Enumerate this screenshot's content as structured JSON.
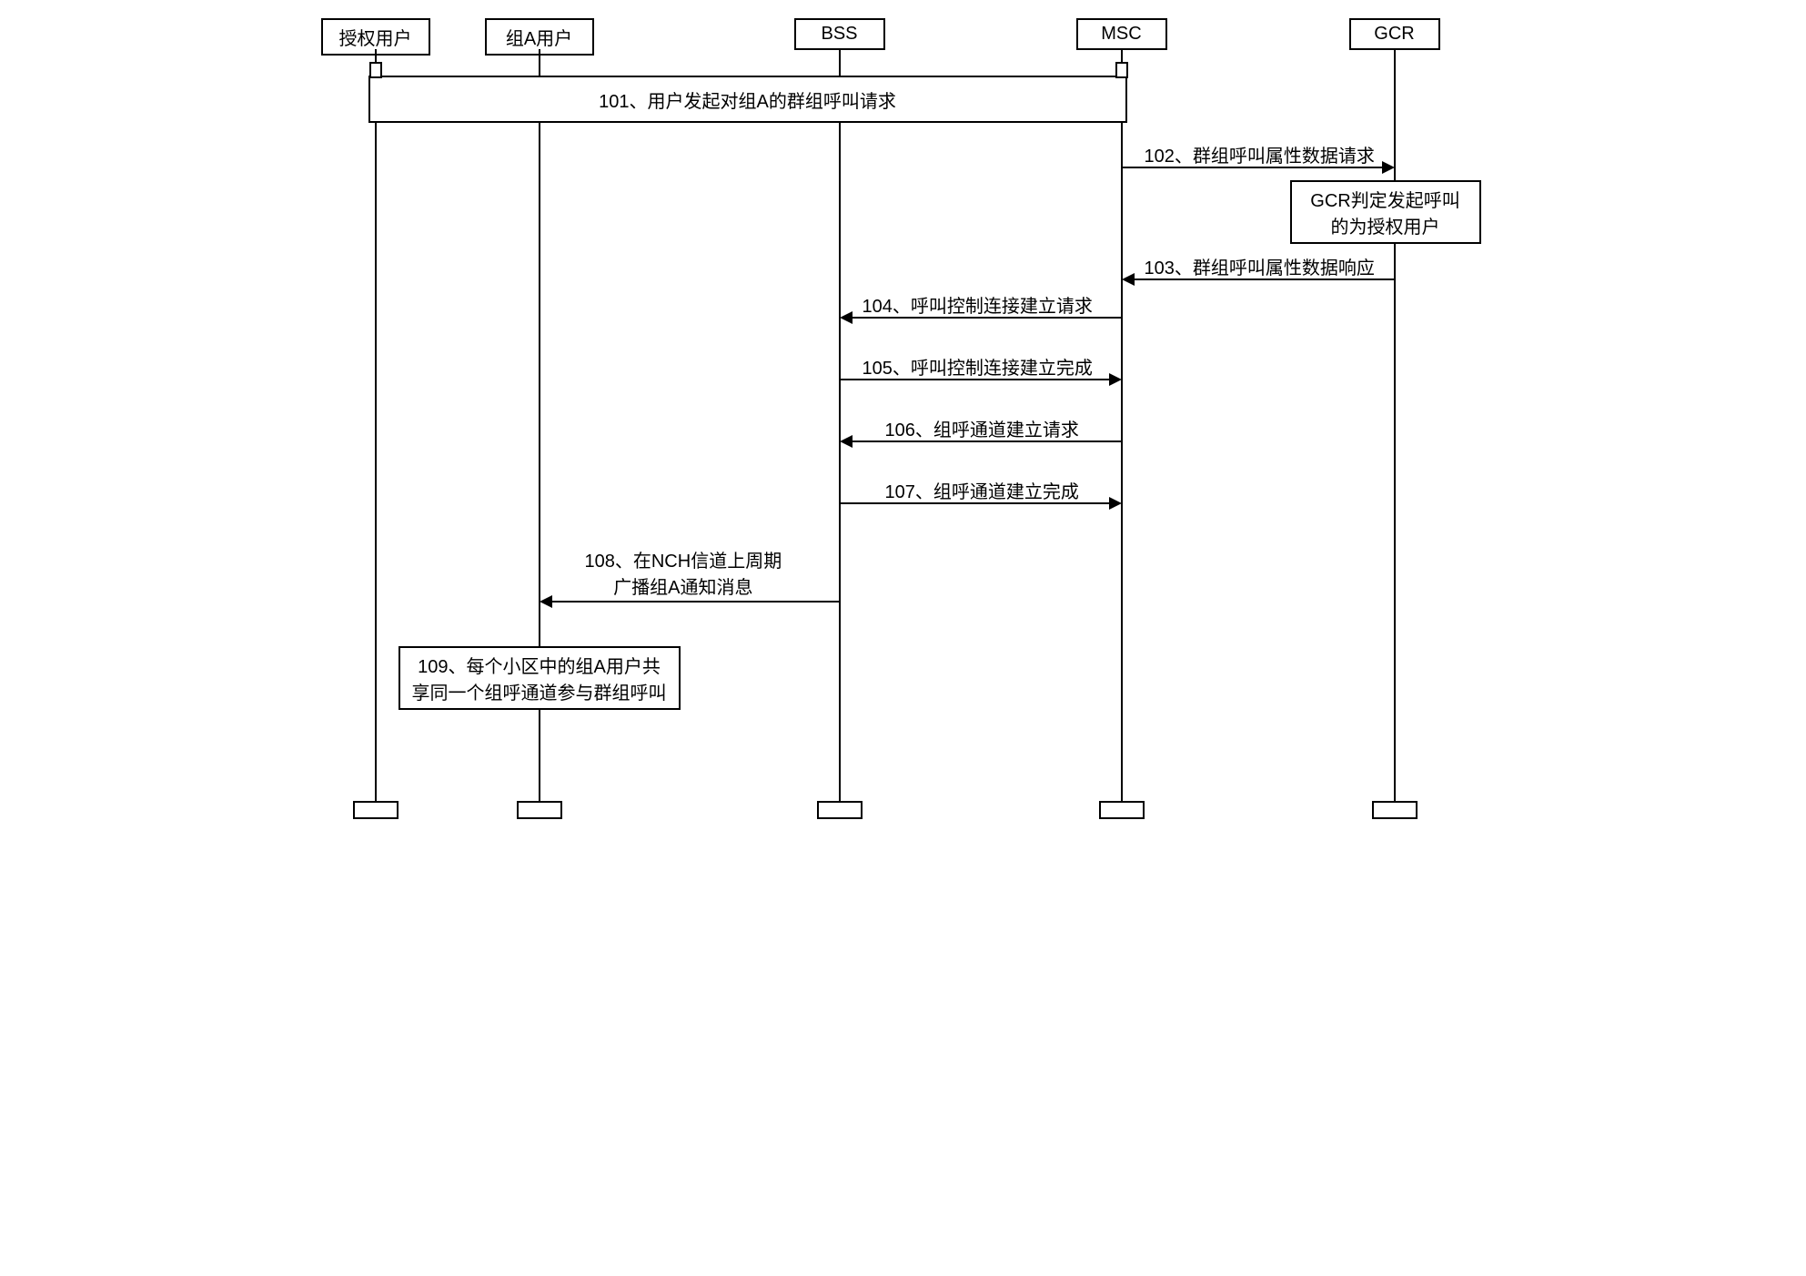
{
  "actors": {
    "auth_user": "授权用户",
    "group_a_user": "组A用户",
    "bss": "BSS",
    "msc": "MSC",
    "gcr": "GCR"
  },
  "messages": {
    "m101": "101、用户发起对组A的群组呼叫请求",
    "m102": "102、群组呼叫属性数据请求",
    "m102_note_l1": "GCR判定发起呼叫",
    "m102_note_l2": "的为授权用户",
    "m103": "103、群组呼叫属性数据响应",
    "m104": "104、呼叫控制连接建立请求",
    "m105": "105、呼叫控制连接建立完成",
    "m106": "106、组呼通道建立请求",
    "m107": "107、组呼通道建立完成",
    "m108_l1": "108、在NCH信道上周期",
    "m108_l2": "广播组A通知消息",
    "m109_l1": "109、每个小区中的组A用户共",
    "m109_l2": "享同一个组呼通道参与群组呼叫"
  }
}
